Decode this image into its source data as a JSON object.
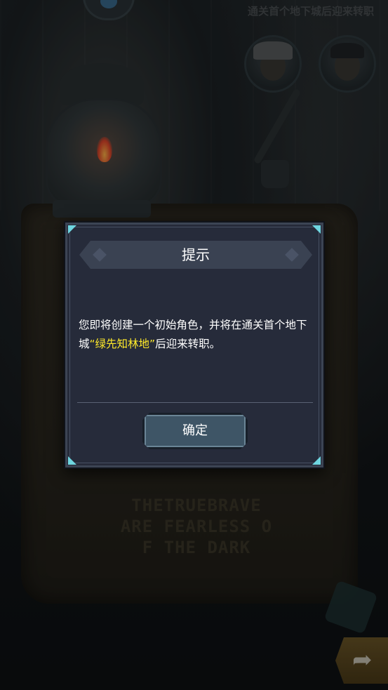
{
  "background": {
    "top_hint": "通关首个地下城后迎来转职",
    "parchment_motto": "THETRUEBRAVE\nARE FEARLESS O\nF THE DARK"
  },
  "dialog": {
    "title": "提示",
    "message_before": "您即将创建一个初始角色，并将在通关首个地下城",
    "message_highlight": "“绿先知林地”",
    "message_after": "后迎来转职。",
    "confirm_label": "确定"
  },
  "colors": {
    "dialog_bg": "#262b3a",
    "highlight": "#ffea2a",
    "accent_corner": "#6fd6e0",
    "button_bg": "#3e5566"
  },
  "icons": {
    "next": "arrow-right-icon",
    "portrait_a": "hero-portrait-ninja",
    "portrait_b": "hero-portrait-swordsman",
    "top_badge": "bird-icon"
  }
}
